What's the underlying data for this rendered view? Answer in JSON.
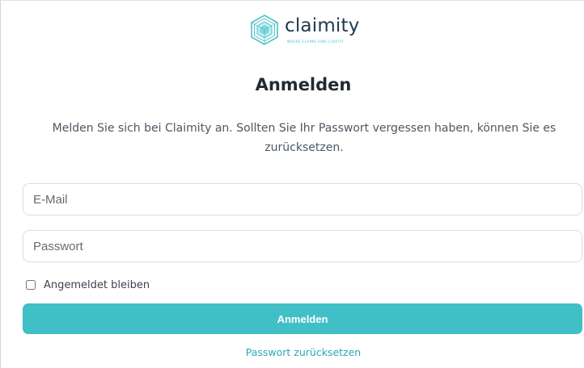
{
  "brand": {
    "name": "claimity",
    "tagline": "WHERE CLAIMS FIND CLARITY",
    "icon": "claimity-hexagon-logo",
    "color_primary": "#40bfc6",
    "color_text": "#1f3a4b"
  },
  "login": {
    "title": "Anmelden",
    "description": "Melden Sie sich bei Claimity an. Sollten Sie Ihr Passwort vergessen haben, können Sie es zurücksetzen.",
    "email": {
      "placeholder": "E-Mail",
      "value": ""
    },
    "password": {
      "placeholder": "Passwort",
      "value": ""
    },
    "remember": {
      "label": "Angemeldet bleiben",
      "checked": false
    },
    "submit_label": "Anmelden",
    "reset_link": "Passwort zurücksetzen"
  }
}
